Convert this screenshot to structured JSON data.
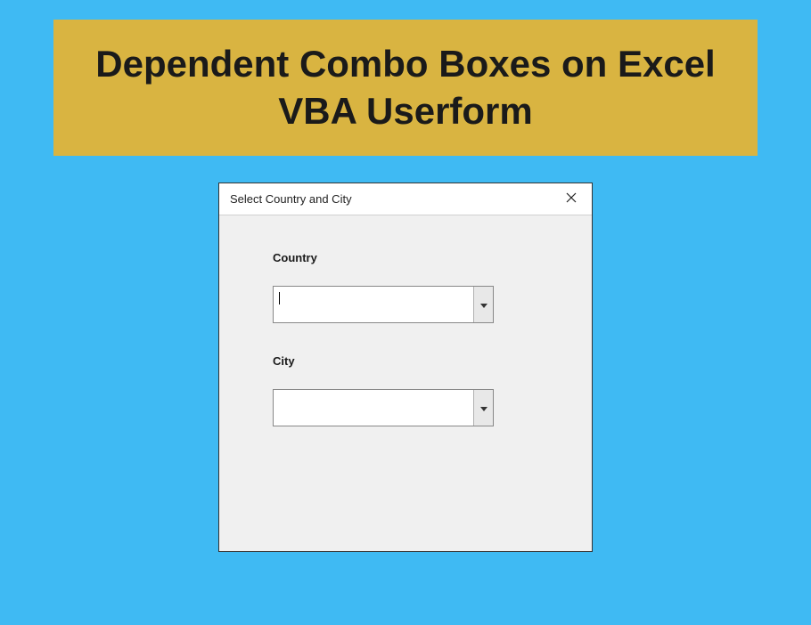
{
  "banner": {
    "title": "Dependent Combo Boxes on Excel VBA Userform"
  },
  "userform": {
    "title": "Select Country and City",
    "fields": {
      "country": {
        "label": "Country",
        "value": "",
        "has_cursor": true
      },
      "city": {
        "label": "City",
        "value": ""
      }
    }
  },
  "colors": {
    "background": "#3fbaf3",
    "banner_bg": "#d9b441",
    "form_bg": "#f0f0f0"
  }
}
